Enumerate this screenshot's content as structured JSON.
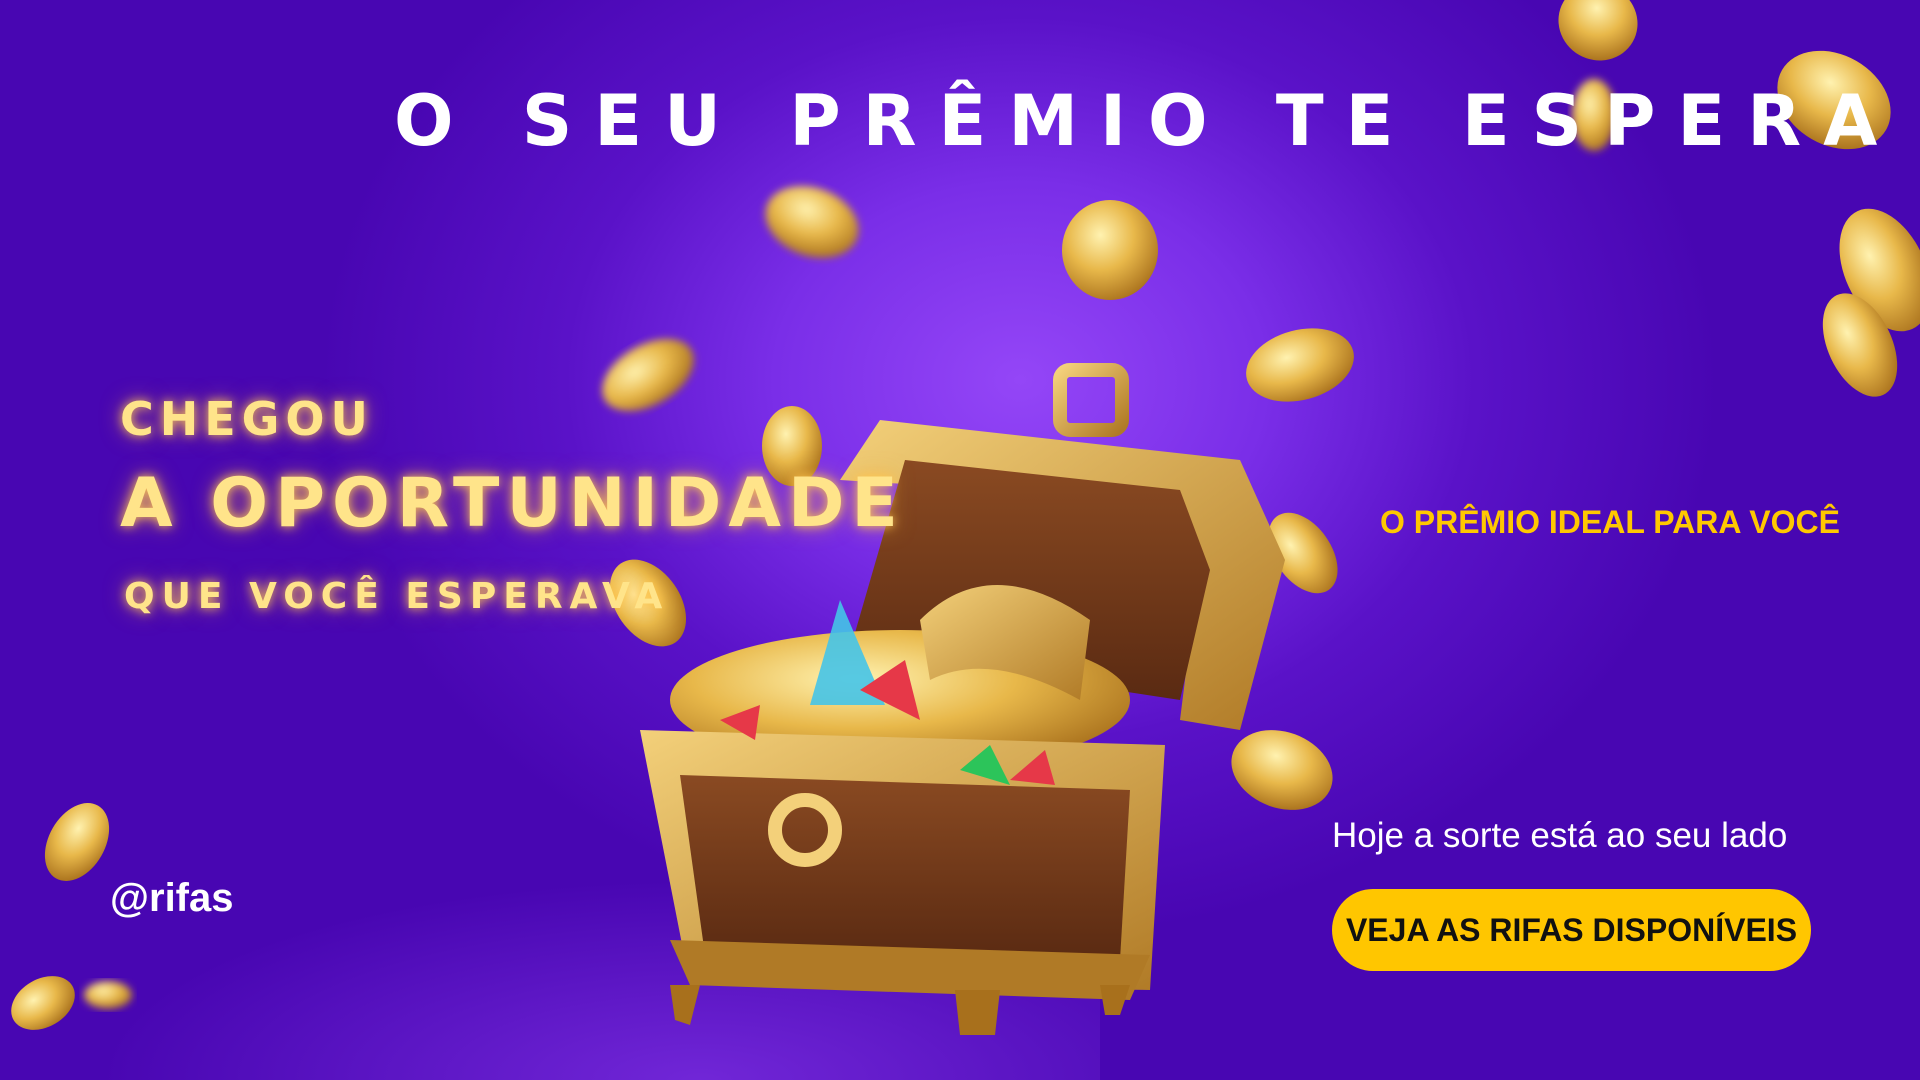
{
  "title": "O SEU PRÊMIO TE ESPERA",
  "headline": {
    "line1": "CHEGOU",
    "line2": "A OPORTUNIDADE",
    "line3": "QUE VOCÊ ESPERAVA"
  },
  "subtitle": "O PRÊMIO IDEAL PARA VOCÊ",
  "tagline": "Hoje a sorte está ao seu lado",
  "cta_label": "VEJA AS RIFAS DISPONÍVEIS",
  "handle": "@rifas",
  "colors": {
    "accent": "#ffc600",
    "background": "#4806b2",
    "neon": "#ffe48a"
  }
}
